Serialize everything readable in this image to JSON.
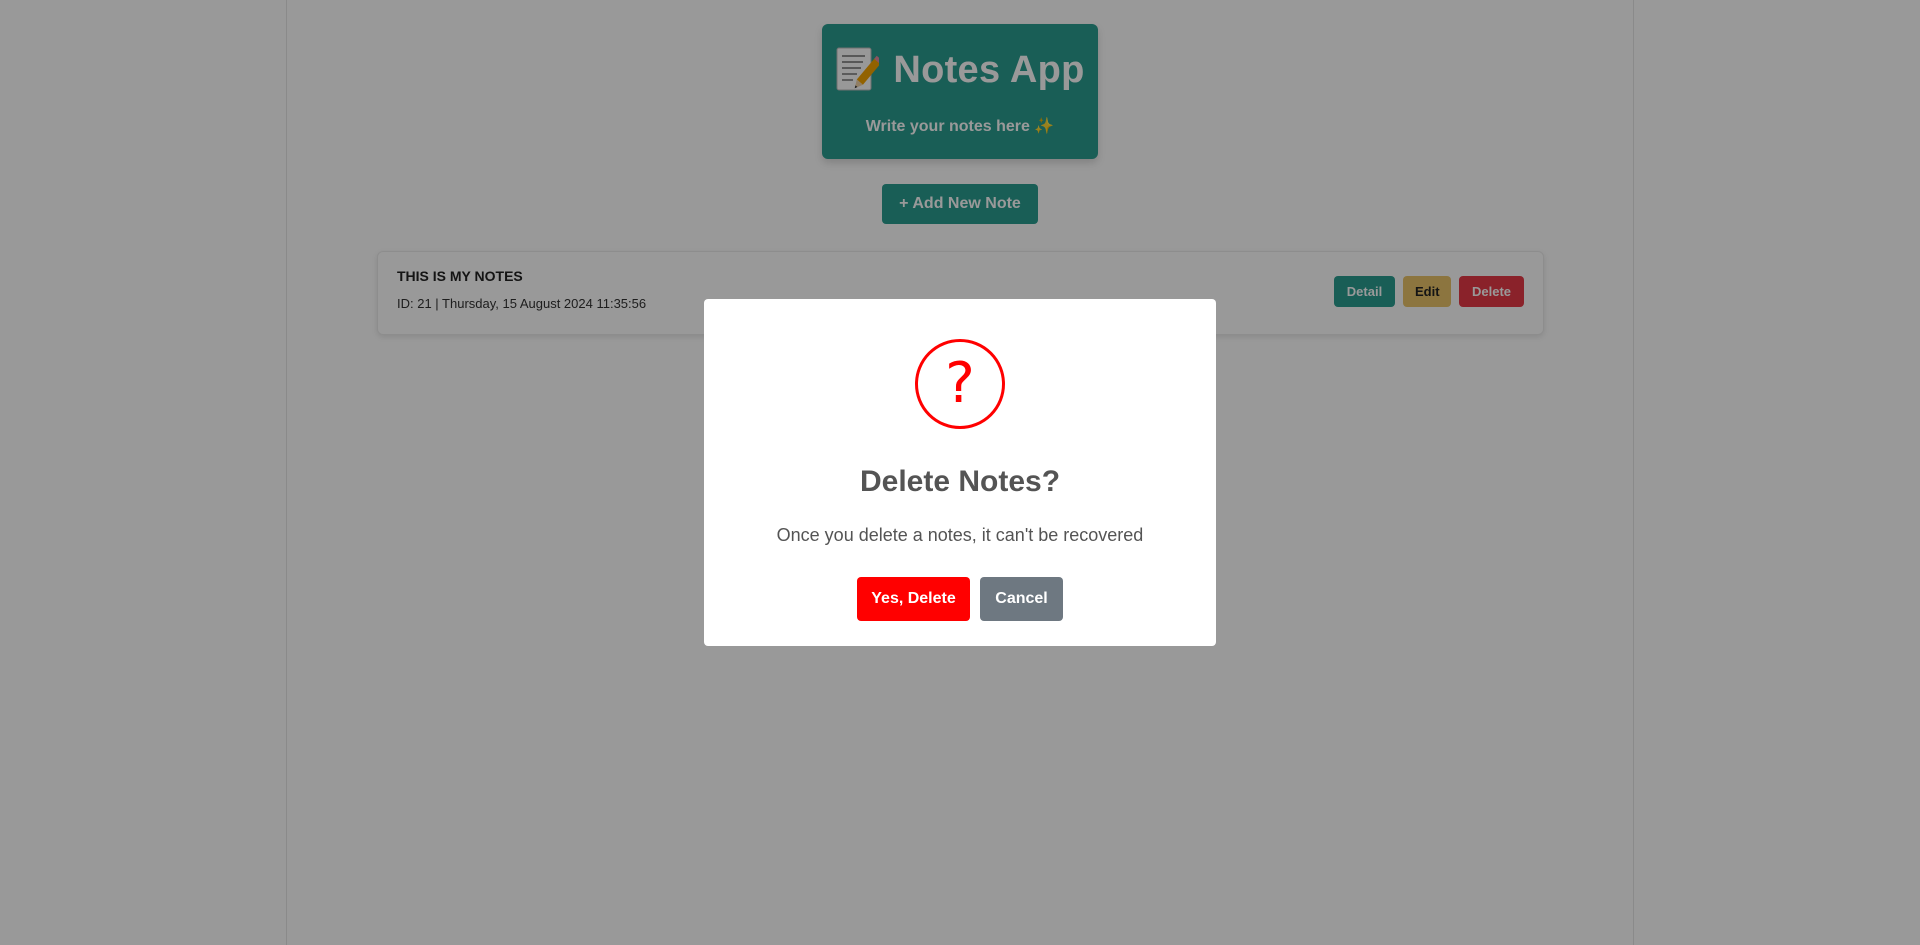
{
  "header": {
    "icon": "memo-icon",
    "title": "Notes App",
    "subtitle": "Write your notes here ✨",
    "color": "#2a9d8f"
  },
  "toolbar": {
    "add_label": "+ Add New Note"
  },
  "notes": [
    {
      "title": "THIS IS MY NOTES",
      "meta": "ID: 21 | Thursday, 15 August 2024 11:35:56",
      "actions": {
        "detail": "Detail",
        "edit": "Edit",
        "delete": "Delete"
      }
    }
  ],
  "modal": {
    "icon": "question-icon",
    "icon_glyph": "?",
    "title": "Delete Notes?",
    "text": "Once you delete a notes, it can't be recovered",
    "confirm_label": "Yes, Delete",
    "cancel_label": "Cancel",
    "confirm_color": "#ff0000",
    "cancel_color": "#6e7881"
  }
}
